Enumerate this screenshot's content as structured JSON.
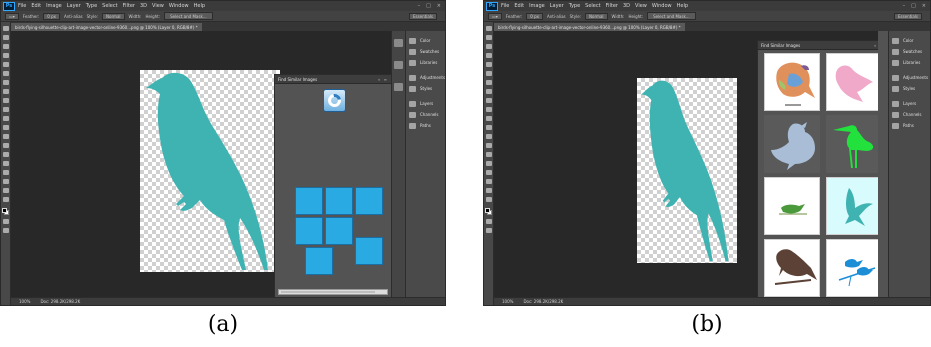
{
  "app": {
    "logo": "Ps",
    "menu_items": [
      "File",
      "Edit",
      "Image",
      "Layer",
      "Type",
      "Select",
      "Filter",
      "3D",
      "View",
      "Window",
      "Help"
    ],
    "window_controls": [
      "–",
      "□",
      "×"
    ]
  },
  "options_bar": {
    "feather_label": "Feather:",
    "feather_value": "0 px",
    "antialias_label": "Anti-alias",
    "style_label": "Style:",
    "style_value": "Normal",
    "width_label": "Width:",
    "height_label": "Height:",
    "select_mask_label": "Select and Mask...",
    "workspace_value": "Essentials"
  },
  "panel_a": {
    "doc_tab": "birds-flying-silhouette-clip-art-image-vector-online-9360...png @ 100% (Layer 0, RGB/8#) *",
    "status_zoom": "100%",
    "status_doc": "Doc: 298.2K/298.2K",
    "search_panel_title": "Find Similar Images",
    "caption": "(a)"
  },
  "panel_b": {
    "doc_tab": "birds-flying-silhouette-clip-art-image-vector-online-9360...png @ 100% (Layer 0, RGB/8#) *",
    "status_zoom": "100%",
    "status_doc": "Doc: 298.2K/298.2K",
    "results_panel_title": "Find Similar Images",
    "caption": "(b)"
  },
  "dock_panels": [
    "Color",
    "Swatches",
    "Libraries",
    "Adjustments",
    "Styles",
    "Layers",
    "Channels",
    "Paths"
  ],
  "colors": {
    "bird_teal": "#3fb3b1",
    "tile_blue": "#29aae2",
    "ps_dark": "#535353"
  }
}
